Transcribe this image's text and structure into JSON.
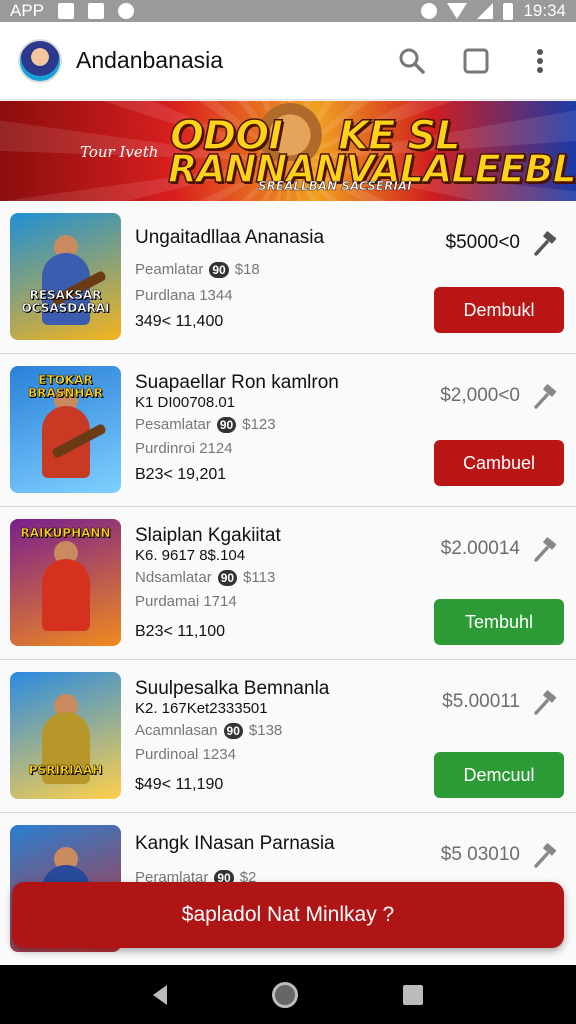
{
  "status_bar": {
    "left_label": "APP",
    "time": "19:34"
  },
  "app_bar": {
    "title": "Andanbanasia"
  },
  "banner": {
    "tag": "Tour Iveth",
    "line1a": "ODOI",
    "line1b": "KE SL",
    "line2": "RANNANVALALEEBL!",
    "line3": "SREALLBAN SACSERIAI"
  },
  "items": [
    {
      "title": "Ungaitadllaa Ananasia",
      "code": "",
      "meta1": "Peamlatar",
      "badge": "90",
      "meta1_value": "$18",
      "meta2": "Purdlana 1344",
      "count": "349< 11,400",
      "price": "$5000<0",
      "button": "Dembukl",
      "button_color": "#b91514",
      "thumb_caption": "RESAKSAR OCSASDARAI",
      "thumb_top": "",
      "colors": [
        "#1e8fd4",
        "#f4b41e"
      ]
    },
    {
      "title": "Suapaellar Ron kamlron",
      "code": "K1 DI00708.01",
      "meta1": "Pesamlatar",
      "badge": "90",
      "meta1_value": "$123",
      "meta2": "Purdinroi 2124",
      "count": "B23< 19,201",
      "price": "$2,000<0",
      "button": "Cambuel",
      "button_color": "#b91514",
      "thumb_caption": "",
      "thumb_top": "ETOKAR BRASNHAR",
      "colors": [
        "#2a80d8",
        "#7fd0ff"
      ]
    },
    {
      "title": "Slaiplan Kgakiitat",
      "code": "K6. 9617 8$.104",
      "meta1": "Ndsamlatar",
      "badge": "90",
      "meta1_value": "$113",
      "meta2": "Purdamai 1714",
      "count": "B23< 11,100",
      "price": "$2.00014",
      "button": "Tembuhl",
      "button_color": "#2c9a35",
      "thumb_caption": "",
      "thumb_top": "RAIKUPHANN",
      "colors": [
        "#7a1f8f",
        "#f08a1e"
      ]
    },
    {
      "title": "Suulpesalka Bemnanla",
      "code": "K2. 167Ket2333501",
      "meta1": "Acamnlasan",
      "badge": "90",
      "meta1_value": "$138",
      "meta2": "Purdinoal 1234",
      "count": "$49< 11,190",
      "price": "$5.00011",
      "button": "Demcuul",
      "button_color": "#2c9a35",
      "thumb_caption": "PSRIRIAAH",
      "thumb_top": "",
      "colors": [
        "#2a8be0",
        "#ffd04a"
      ]
    },
    {
      "title": "Kangk INasan Parnasia",
      "code": "",
      "meta1": "Peramlatar",
      "badge": "90",
      "meta1_value": "$2",
      "meta2": "",
      "count": "",
      "price": "$5 03010",
      "button": "",
      "button_color": "",
      "thumb_caption": "",
      "thumb_top": "",
      "colors": [
        "#2a7fd0",
        "#c63030"
      ]
    }
  ],
  "cta": {
    "label": "$apladol Nat Minlkay ?"
  }
}
